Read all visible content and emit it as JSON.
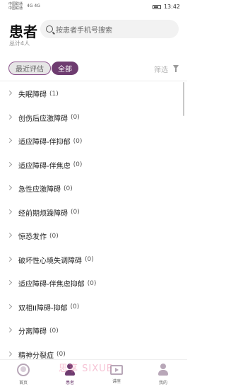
{
  "status_bar": {
    "carrier1": "中国联通",
    "carrier2": "中国联通",
    "signal": "4G 4G",
    "time": "13:42"
  },
  "header": {
    "title": "患者",
    "total": "总计4人",
    "search_placeholder": "按患者手机号搜索"
  },
  "filters": {
    "tab_recent": "最近评估",
    "tab_all": "全部",
    "filter_label": "筛选"
  },
  "list": [
    {
      "name": "失眠障碍",
      "count": "(1)"
    },
    {
      "name": "创伤后应激障碍",
      "count": "(0)"
    },
    {
      "name": "适应障碍-伴抑郁",
      "count": "(0)"
    },
    {
      "name": "适应障碍-伴焦虑",
      "count": "(0)"
    },
    {
      "name": "急性应激障碍",
      "count": "(0)"
    },
    {
      "name": "经前期烦躁障碍",
      "count": "(0)"
    },
    {
      "name": "惊恐发作",
      "count": "(0)"
    },
    {
      "name": "破坏性心境失调障碍",
      "count": "(0)"
    },
    {
      "name": "适应障碍-伴焦虑抑郁",
      "count": "(0)"
    },
    {
      "name": "双相II障碍-抑郁",
      "count": "(0)"
    },
    {
      "name": "分离障碍",
      "count": "(0)"
    },
    {
      "name": "精神分裂症",
      "count": "(0)"
    }
  ],
  "bottom_nav": {
    "home": "首页",
    "patients": "患者",
    "lecture": "讲座",
    "mine": "我的",
    "active_color": "#6e3c70"
  },
  "watermark": "思享 SIXUE"
}
